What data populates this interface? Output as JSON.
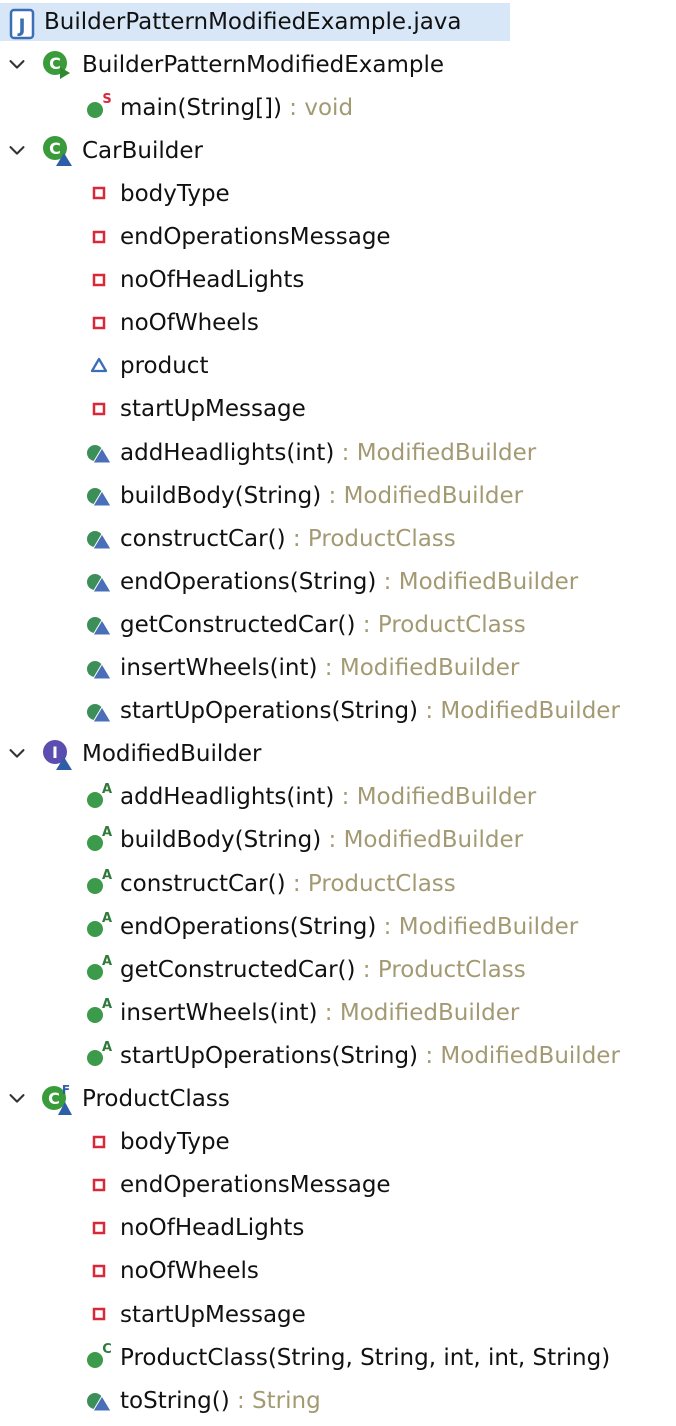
{
  "colors": {
    "selection": "#d8e7f8",
    "return_type": "#a39a73",
    "class_green": "#3a9b3a",
    "private_red": "#d8283a",
    "package_blue": "#3a6fb5",
    "interface_purple": "#5a4fb0",
    "method_default": "#3d8f5a"
  },
  "outline": [
    {
      "type": "file",
      "icon": "java-file-icon",
      "label": "BuilderPatternModifiedExample.java"
    },
    {
      "type": "class",
      "icon": "public-class-icon",
      "label": "BuilderPatternModifiedExample",
      "expanded": true,
      "members": [
        {
          "icon": "static-method-icon",
          "sig": "main(String[])",
          "ret": ": void"
        }
      ]
    },
    {
      "type": "class",
      "icon": "abstract-class-icon",
      "label": "CarBuilder",
      "expanded": true,
      "members": [
        {
          "icon": "private-field-icon",
          "sig": "bodyType",
          "ret": ""
        },
        {
          "icon": "private-field-icon",
          "sig": "endOperationsMessage",
          "ret": ""
        },
        {
          "icon": "private-field-icon",
          "sig": "noOfHeadLights",
          "ret": ""
        },
        {
          "icon": "private-field-icon",
          "sig": "noOfWheels",
          "ret": ""
        },
        {
          "icon": "package-field-icon",
          "sig": "product",
          "ret": ""
        },
        {
          "icon": "private-field-icon",
          "sig": "startUpMessage",
          "ret": ""
        },
        {
          "icon": "default-method-icon",
          "sig": "addHeadlights(int)",
          "ret": ": ModifiedBuilder"
        },
        {
          "icon": "default-method-icon",
          "sig": "buildBody(String)",
          "ret": ": ModifiedBuilder"
        },
        {
          "icon": "default-method-icon",
          "sig": "constructCar()",
          "ret": ": ProductClass"
        },
        {
          "icon": "default-method-icon",
          "sig": "endOperations(String)",
          "ret": ": ModifiedBuilder"
        },
        {
          "icon": "default-method-icon",
          "sig": "getConstructedCar()",
          "ret": ": ProductClass"
        },
        {
          "icon": "default-method-icon",
          "sig": "insertWheels(int)",
          "ret": ": ModifiedBuilder"
        },
        {
          "icon": "default-method-icon",
          "sig": "startUpOperations(String)",
          "ret": ": ModifiedBuilder"
        }
      ]
    },
    {
      "type": "class",
      "icon": "interface-icon",
      "label": "ModifiedBuilder",
      "expanded": true,
      "members": [
        {
          "icon": "abstract-method-icon",
          "sig": "addHeadlights(int)",
          "ret": ": ModifiedBuilder"
        },
        {
          "icon": "abstract-method-icon",
          "sig": "buildBody(String)",
          "ret": ": ModifiedBuilder"
        },
        {
          "icon": "abstract-method-icon",
          "sig": "constructCar()",
          "ret": ": ProductClass"
        },
        {
          "icon": "abstract-method-icon",
          "sig": "endOperations(String)",
          "ret": ": ModifiedBuilder"
        },
        {
          "icon": "abstract-method-icon",
          "sig": "getConstructedCar()",
          "ret": ": ProductClass"
        },
        {
          "icon": "abstract-method-icon",
          "sig": "insertWheels(int)",
          "ret": ": ModifiedBuilder"
        },
        {
          "icon": "abstract-method-icon",
          "sig": "startUpOperations(String)",
          "ret": ": ModifiedBuilder"
        }
      ]
    },
    {
      "type": "class",
      "icon": "final-class-icon",
      "label": "ProductClass",
      "expanded": true,
      "members": [
        {
          "icon": "private-field-icon",
          "sig": "bodyType",
          "ret": ""
        },
        {
          "icon": "private-field-icon",
          "sig": "endOperationsMessage",
          "ret": ""
        },
        {
          "icon": "private-field-icon",
          "sig": "noOfHeadLights",
          "ret": ""
        },
        {
          "icon": "private-field-icon",
          "sig": "noOfWheels",
          "ret": ""
        },
        {
          "icon": "private-field-icon",
          "sig": "startUpMessage",
          "ret": ""
        },
        {
          "icon": "constructor-icon",
          "sig": "ProductClass(String, String, int, int, String)",
          "ret": ""
        },
        {
          "icon": "default-method-icon",
          "sig": "toString()",
          "ret": ": String"
        }
      ]
    }
  ]
}
